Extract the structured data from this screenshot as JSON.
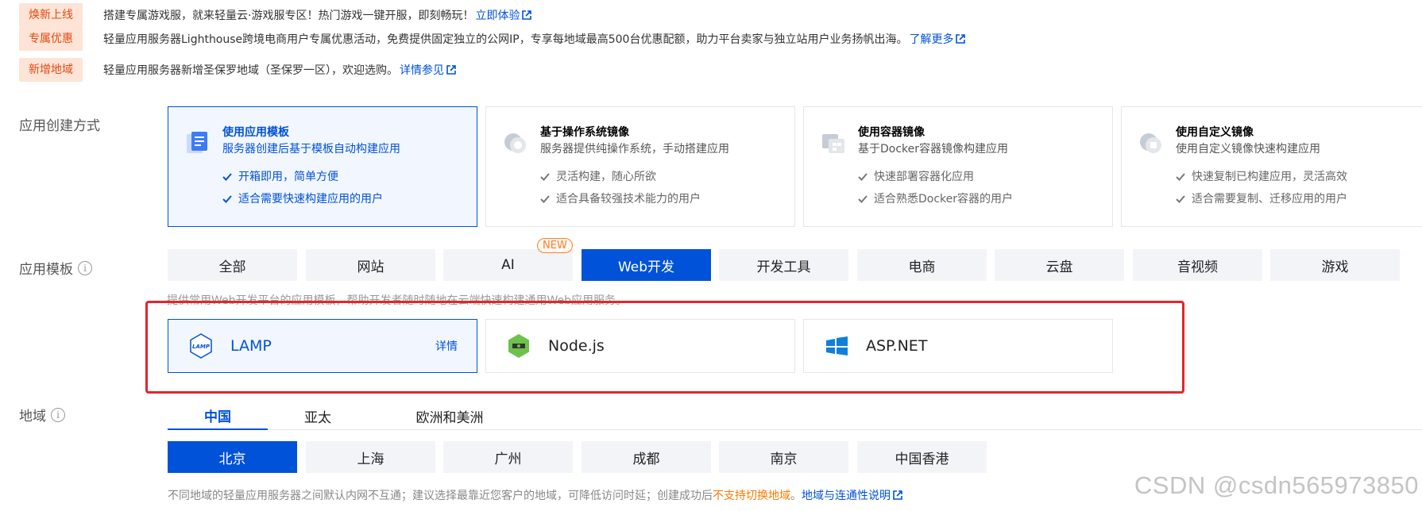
{
  "notices": [
    {
      "tag": "焕新上线",
      "text": "搭建专属游戏服，就来轻量云·游戏服专区！热门游戏一键开服，即刻畅玩！",
      "link": "立即体验"
    },
    {
      "tag": "专属优惠",
      "text": "轻量应用服务器Lighthouse跨境电商用户专属优惠活动，免费提供固定独立的公网IP，专享每地域最高500台优惠配额，助力平台卖家与独立站用户业务扬帆出海。",
      "link": "了解更多"
    },
    {
      "tag": "新增地域",
      "text": "轻量应用服务器新增圣保罗地域（圣保罗一区），欢迎选购。",
      "link": "详情参见"
    }
  ],
  "creation": {
    "label": "应用创建方式",
    "cards": [
      {
        "title": "使用应用模板",
        "desc": "服务器创建后基于模板自动构建应用",
        "points": [
          "开箱即用，简单方便",
          "适合需要快速构建应用的用户"
        ],
        "icon": "template-icon"
      },
      {
        "title": "基于操作系统镜像",
        "desc": "服务器提供纯操作系统，手动搭建应用",
        "points": [
          "灵活构建，随心所欲",
          "适合具备较强技术能力的用户"
        ],
        "icon": "os-image-icon"
      },
      {
        "title": "使用容器镜像",
        "desc": "基于Docker容器镜像构建应用",
        "points": [
          "快速部署容器化应用",
          "适合熟悉Docker容器的用户"
        ],
        "icon": "container-image-icon"
      },
      {
        "title": "使用自定义镜像",
        "desc": "使用自定义镜像快速构建应用",
        "points": [
          "快速复制已构建应用，灵活高效",
          "适合需要复制、迁移应用的用户"
        ],
        "icon": "custom-image-icon"
      }
    ]
  },
  "templates": {
    "label": "应用模板",
    "tabs": [
      "全部",
      "网站",
      "AI",
      "Web开发",
      "开发工具",
      "电商",
      "云盘",
      "音视频",
      "游戏"
    ],
    "active_tab": "Web开发",
    "new_badge": "NEW",
    "hint": "提供常用Web开发平台的应用模板，帮助开发者随时随地在云端快速构建通用Web应用服务。",
    "items": [
      {
        "name": "LAMP",
        "detail": "详情",
        "logo_text": "LAMP"
      },
      {
        "name": "Node.js"
      },
      {
        "name": "ASP.NET"
      }
    ]
  },
  "region": {
    "label": "地域",
    "tabs": [
      "中国",
      "亚太",
      "欧洲和美洲"
    ],
    "cities": [
      "北京",
      "上海",
      "广州",
      "成都",
      "南京",
      "中国香港"
    ],
    "note_prefix": "不同地域的轻量应用服务器之间默认内网不互通；建议选择最靠近您客户的地域，可降低访问时延；创建成功后",
    "note_warn": "不支持切换地域",
    "note_sep": "。",
    "note_link": "地域与连通性说明"
  },
  "watermark": "CSDN @csdn565973850",
  "colors": {
    "brand": "#0052d9",
    "tag_bg": "#fde4d6",
    "tag_fg": "#e24a13",
    "highlight": "#e5252a"
  }
}
